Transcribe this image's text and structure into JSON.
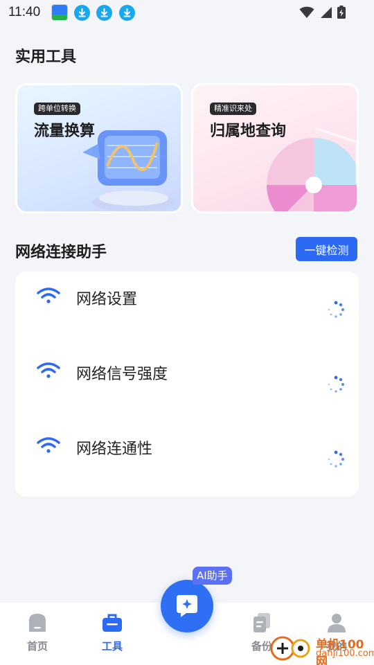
{
  "status_bar": {
    "time": "11:40",
    "download_icons": [
      "download-icon",
      "download-icon",
      "download-icon"
    ]
  },
  "tools_section": {
    "title": "实用工具",
    "cards": [
      {
        "tag": "跨单位转换",
        "title": "流量换算"
      },
      {
        "tag": "精准识来处",
        "title": "归属地查询"
      }
    ]
  },
  "network_section": {
    "title": "网络连接助手",
    "detect_button": "一键检测",
    "items": [
      {
        "label": "网络设置"
      },
      {
        "label": "网络信号强度"
      },
      {
        "label": "网络连通性"
      }
    ]
  },
  "ai_button": {
    "badge": "AI助手"
  },
  "bottom_nav": {
    "items": [
      {
        "label": "首页",
        "icon": "home-icon",
        "active": false
      },
      {
        "label": "工具",
        "icon": "toolbox-icon",
        "active": true
      },
      {
        "label": "备份",
        "icon": "backup-icon",
        "active": false
      },
      {
        "label": "我的",
        "icon": "profile-icon",
        "active": false
      }
    ]
  },
  "watermark": {
    "brand": "单机100网",
    "url": "danji100.com"
  },
  "colors": {
    "accent": "#2c6af4",
    "background": "#f4f5f8"
  }
}
